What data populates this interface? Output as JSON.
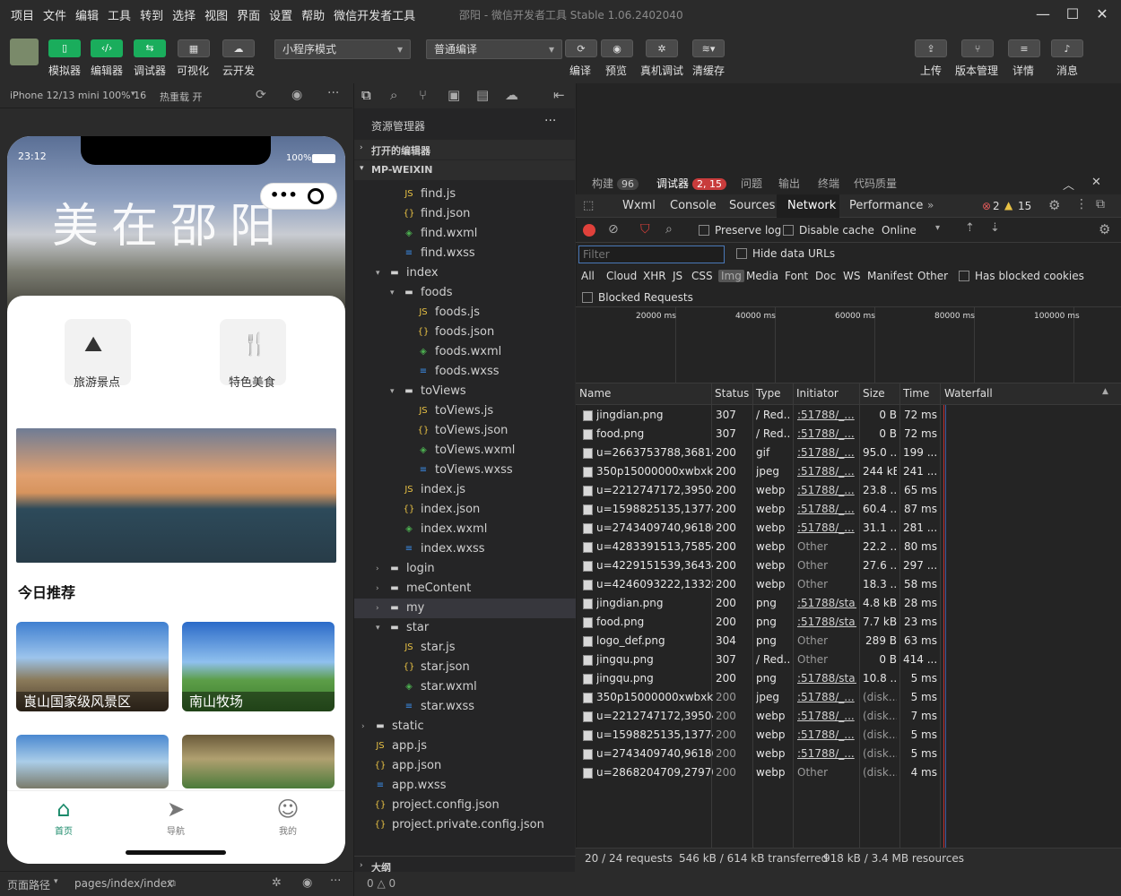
{
  "menu": [
    "项目",
    "文件",
    "编辑",
    "工具",
    "转到",
    "选择",
    "视图",
    "界面",
    "设置",
    "帮助",
    "微信开发者工具"
  ],
  "window_title": "邵阳 - 微信开发者工具 Stable 1.06.2402040",
  "toolbar": {
    "left": [
      "模拟器",
      "编辑器",
      "调试器",
      "可视化",
      "云开发"
    ],
    "mode": "小程序模式",
    "compile_mode": "普通编译",
    "actions": [
      "编译",
      "预览",
      "真机调试",
      "清缓存"
    ],
    "right": [
      "上传",
      "版本管理",
      "详情",
      "消息"
    ]
  },
  "sim": {
    "device": "iPhone 12/13 mini 100% 16",
    "hot_reload": "热重载 开",
    "time": "23:12",
    "battery": "100%",
    "hero_text": "美在邵阳",
    "categories": [
      "旅游景点",
      "特色美食"
    ],
    "rec_title": "今日推荐",
    "rec_items": [
      "崀山国家级风景区",
      "南山牧场"
    ],
    "tabs": [
      "首页",
      "导航",
      "我的"
    ],
    "footer_path_label": "页面路径",
    "footer_path": "pages/index/index",
    "footer_status": "0 △ 0"
  },
  "explorer": {
    "title": "资源管理器",
    "sections": [
      "打开的编辑器",
      "MP-WEIXIN"
    ],
    "items": [
      {
        "name": "find.js",
        "type": "js",
        "d": 2
      },
      {
        "name": "find.json",
        "type": "json",
        "d": 2
      },
      {
        "name": "find.wxml",
        "type": "wxml",
        "d": 2
      },
      {
        "name": "find.wxss",
        "type": "wxss",
        "d": 2
      },
      {
        "name": "index",
        "type": "folder",
        "d": 1,
        "open": true
      },
      {
        "name": "foods",
        "type": "folder",
        "d": 2,
        "open": true
      },
      {
        "name": "foods.js",
        "type": "js",
        "d": 3
      },
      {
        "name": "foods.json",
        "type": "json",
        "d": 3
      },
      {
        "name": "foods.wxml",
        "type": "wxml",
        "d": 3
      },
      {
        "name": "foods.wxss",
        "type": "wxss",
        "d": 3
      },
      {
        "name": "toViews",
        "type": "folder",
        "d": 2,
        "open": true
      },
      {
        "name": "toViews.js",
        "type": "js",
        "d": 3
      },
      {
        "name": "toViews.json",
        "type": "json",
        "d": 3
      },
      {
        "name": "toViews.wxml",
        "type": "wxml",
        "d": 3
      },
      {
        "name": "toViews.wxss",
        "type": "wxss",
        "d": 3
      },
      {
        "name": "index.js",
        "type": "js",
        "d": 2
      },
      {
        "name": "index.json",
        "type": "json",
        "d": 2
      },
      {
        "name": "index.wxml",
        "type": "wxml",
        "d": 2
      },
      {
        "name": "index.wxss",
        "type": "wxss",
        "d": 2
      },
      {
        "name": "login",
        "type": "folder",
        "d": 1
      },
      {
        "name": "meContent",
        "type": "folder",
        "d": 1
      },
      {
        "name": "my",
        "type": "folder",
        "d": 1
      },
      {
        "name": "star",
        "type": "folder",
        "d": 1,
        "open": true
      },
      {
        "name": "star.js",
        "type": "js",
        "d": 2
      },
      {
        "name": "star.json",
        "type": "json",
        "d": 2
      },
      {
        "name": "star.wxml",
        "type": "wxml",
        "d": 2
      },
      {
        "name": "star.wxss",
        "type": "wxss",
        "d": 2
      },
      {
        "name": "static",
        "type": "folder",
        "d": 0
      },
      {
        "name": "app.js",
        "type": "js",
        "d": 0
      },
      {
        "name": "app.json",
        "type": "json",
        "d": 0
      },
      {
        "name": "app.wxss",
        "type": "wxss",
        "d": 0
      },
      {
        "name": "project.config.json",
        "type": "json",
        "d": 0
      },
      {
        "name": "project.private.config.json",
        "type": "json",
        "d": 0
      }
    ],
    "outline": "大纲"
  },
  "devtools": {
    "top_tabs": [
      {
        "l": "构建",
        "b": "96"
      },
      {
        "l": "调试器",
        "b": "2, 15"
      },
      {
        "l": "问题"
      },
      {
        "l": "输出"
      },
      {
        "l": "终端"
      },
      {
        "l": "代码质量"
      }
    ],
    "panel_tabs": [
      "Wxml",
      "Console",
      "Sources",
      "Network",
      "Performance"
    ],
    "errors": "2",
    "warnings": "15",
    "preserve_log": "Preserve log",
    "disable_cache": "Disable cache",
    "online": "Online",
    "filter": "Filter",
    "hide_data_urls": "Hide data URLs",
    "type_filters": [
      "All",
      "Cloud",
      "XHR",
      "JS",
      "CSS",
      "Img",
      "Media",
      "Font",
      "Doc",
      "WS",
      "Manifest",
      "Other"
    ],
    "blocked_cookies": "Has blocked cookies",
    "blocked_requests": "Blocked Requests",
    "timeline": [
      "20000 ms",
      "40000 ms",
      "60000 ms",
      "80000 ms",
      "100000 ms"
    ],
    "columns": [
      "Name",
      "Status",
      "Type",
      "Initiator",
      "Size",
      "Time",
      "Waterfall"
    ],
    "rows": [
      [
        "jingdian.png",
        "307",
        "/ Red...",
        ":51788/_...",
        "0 B",
        "72 ms"
      ],
      [
        "food.png",
        "307",
        "/ Red...",
        ":51788/_...",
        "0 B",
        "72 ms"
      ],
      [
        "u=2663753788,36814...",
        "200",
        "gif",
        ":51788/_...",
        "95.0 ...",
        "199 ..."
      ],
      [
        "350p15000000xwbxk...",
        "200",
        "jpeg",
        ":51788/_...",
        "244 kB",
        "241 ..."
      ],
      [
        "u=2212747172,39504...",
        "200",
        "webp",
        ":51788/_...",
        "23.8 ...",
        "65 ms"
      ],
      [
        "u=1598825135,13774...",
        "200",
        "webp",
        ":51788/_...",
        "60.4 ...",
        "87 ms"
      ],
      [
        "u=2743409740,96186...",
        "200",
        "webp",
        ":51788/_...",
        "31.1 ...",
        "281 ..."
      ],
      [
        "u=4283391513,75854...",
        "200",
        "webp",
        "Other",
        "22.2 ...",
        "80 ms"
      ],
      [
        "u=4229151539,36434...",
        "200",
        "webp",
        "Other",
        "27.6 ...",
        "297 ..."
      ],
      [
        "u=4246093222,13328...",
        "200",
        "webp",
        "Other",
        "18.3 ...",
        "58 ms"
      ],
      [
        "jingdian.png",
        "200",
        "png",
        ":51788/sta...",
        "4.8 kB",
        "28 ms"
      ],
      [
        "food.png",
        "200",
        "png",
        ":51788/sta...",
        "7.7 kB",
        "23 ms"
      ],
      [
        "logo_def.png",
        "304",
        "png",
        "Other",
        "289 B",
        "63 ms"
      ],
      [
        "jingqu.png",
        "307",
        "/ Red...",
        "Other",
        "0 B",
        "414 ..."
      ],
      [
        "jingqu.png",
        "200",
        "png",
        ":51788/sta...",
        "10.8 ...",
        "5 ms"
      ],
      [
        "350p15000000xwbxk...",
        "200",
        "jpeg",
        ":51788/_...",
        "(disk...",
        "5 ms"
      ],
      [
        "u=2212747172,39504...",
        "200",
        "webp",
        ":51788/_...",
        "(disk...",
        "7 ms"
      ],
      [
        "u=1598825135,13774...",
        "200",
        "webp",
        ":51788/_...",
        "(disk...",
        "5 ms"
      ],
      [
        "u=2743409740,96186...",
        "200",
        "webp",
        ":51788/_...",
        "(disk...",
        "5 ms"
      ],
      [
        "u=2868204709,27970...",
        "200",
        "webp",
        "Other",
        "(disk...",
        "4 ms"
      ]
    ],
    "status_bar": [
      "20 / 24 requests",
      "546 kB / 614 kB transferred",
      "918 kB / 3.4 MB resources"
    ]
  },
  "colors": {
    "green": "#1aad5c",
    "red_record": "#e0413b",
    "badge_red": "#c83c3c"
  }
}
